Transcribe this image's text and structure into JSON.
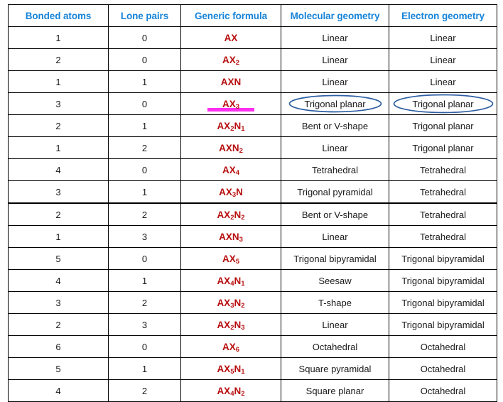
{
  "table": {
    "headers": [
      "Bonded atoms",
      "Lone pairs",
      "Generic formula",
      "Molecular geometry",
      "Electron geometry"
    ],
    "header_color": "#1683d8",
    "formula_color": "#b80f0f",
    "annotation_color": "#2e5fa3",
    "highlight_color": "#ff2ff0",
    "rows": [
      {
        "bonded_atoms": "1",
        "lone_pairs": "0",
        "formula_main": "AX",
        "formula_sub1": "",
        "formula_mid": "",
        "formula_sub2": "",
        "molecular_geometry": "Linear",
        "electron_geometry": "Linear"
      },
      {
        "bonded_atoms": "2",
        "lone_pairs": "0",
        "formula_main": "AX",
        "formula_sub1": "2",
        "formula_mid": "",
        "formula_sub2": "",
        "molecular_geometry": "Linear",
        "electron_geometry": "Linear"
      },
      {
        "bonded_atoms": "1",
        "lone_pairs": "1",
        "formula_main": "AX",
        "formula_sub1": "",
        "formula_mid": "N",
        "formula_sub2": "",
        "molecular_geometry": "Linear",
        "electron_geometry": "Linear"
      },
      {
        "bonded_atoms": "3",
        "lone_pairs": "0",
        "formula_main": "AX",
        "formula_sub1": "3",
        "formula_mid": "",
        "formula_sub2": "",
        "molecular_geometry": "Trigonal planar",
        "electron_geometry": "Trigonal planar"
      },
      {
        "bonded_atoms": "2",
        "lone_pairs": "1",
        "formula_main": "AX",
        "formula_sub1": "2",
        "formula_mid": "N",
        "formula_sub2": "1",
        "molecular_geometry": "Bent or V-shape",
        "electron_geometry": "Trigonal planar"
      },
      {
        "bonded_atoms": "1",
        "lone_pairs": "2",
        "formula_main": "AX",
        "formula_sub1": "",
        "formula_mid": "N",
        "formula_sub2": "2",
        "molecular_geometry": "Linear",
        "electron_geometry": "Trigonal planar"
      },
      {
        "bonded_atoms": "4",
        "lone_pairs": "0",
        "formula_main": "AX",
        "formula_sub1": "4",
        "formula_mid": "",
        "formula_sub2": "",
        "molecular_geometry": "Tetrahedral",
        "electron_geometry": "Tetrahedral"
      },
      {
        "bonded_atoms": "3",
        "lone_pairs": "1",
        "formula_main": "AX",
        "formula_sub1": "3",
        "formula_mid": "N",
        "formula_sub2": "",
        "molecular_geometry": "Trigonal pyramidal",
        "electron_geometry": "Tetrahedral"
      },
      {
        "bonded_atoms": "2",
        "lone_pairs": "2",
        "formula_main": "AX",
        "formula_sub1": "2",
        "formula_mid": "N",
        "formula_sub2": "2",
        "molecular_geometry": "Bent or V-shape",
        "electron_geometry": "Tetrahedral"
      },
      {
        "bonded_atoms": "1",
        "lone_pairs": "3",
        "formula_main": "AX",
        "formula_sub1": "",
        "formula_mid": "N",
        "formula_sub2": "3",
        "molecular_geometry": "Linear",
        "electron_geometry": "Tetrahedral"
      },
      {
        "bonded_atoms": "5",
        "lone_pairs": "0",
        "formula_main": "AX",
        "formula_sub1": "5",
        "formula_mid": "",
        "formula_sub2": "",
        "molecular_geometry": "Trigonal bipyramidal",
        "electron_geometry": "Trigonal bipyramidal"
      },
      {
        "bonded_atoms": "4",
        "lone_pairs": "1",
        "formula_main": "AX",
        "formula_sub1": "4",
        "formula_mid": "N",
        "formula_sub2": "1",
        "molecular_geometry": "Seesaw",
        "electron_geometry": "Trigonal bipyramidal"
      },
      {
        "bonded_atoms": "3",
        "lone_pairs": "2",
        "formula_main": "AX",
        "formula_sub1": "3",
        "formula_mid": "N",
        "formula_sub2": "2",
        "molecular_geometry": "T-shape",
        "electron_geometry": "Trigonal bipyramidal"
      },
      {
        "bonded_atoms": "2",
        "lone_pairs": "3",
        "formula_main": "AX",
        "formula_sub1": "2",
        "formula_mid": "N",
        "formula_sub2": "3",
        "molecular_geometry": "Linear",
        "electron_geometry": "Trigonal bipyramidal"
      },
      {
        "bonded_atoms": "6",
        "lone_pairs": "0",
        "formula_main": "AX",
        "formula_sub1": "6",
        "formula_mid": "",
        "formula_sub2": "",
        "molecular_geometry": "Octahedral",
        "electron_geometry": "Octahedral"
      },
      {
        "bonded_atoms": "5",
        "lone_pairs": "1",
        "formula_main": "AX",
        "formula_sub1": "5",
        "formula_mid": "N",
        "formula_sub2": "1",
        "molecular_geometry": "Square pyramidal",
        "electron_geometry": "Octahedral"
      },
      {
        "bonded_atoms": "4",
        "lone_pairs": "2",
        "formula_main": "AX",
        "formula_sub1": "4",
        "formula_mid": "N",
        "formula_sub2": "2",
        "molecular_geometry": "Square planar",
        "electron_geometry": "Octahedral"
      }
    ]
  },
  "annotations": {
    "highlighted_formula_row_index": 3,
    "circled_molecular_geometry_row_index": 3,
    "circled_electron_geometry_row_index": 3,
    "thick_rule_above_row_index": 8
  }
}
